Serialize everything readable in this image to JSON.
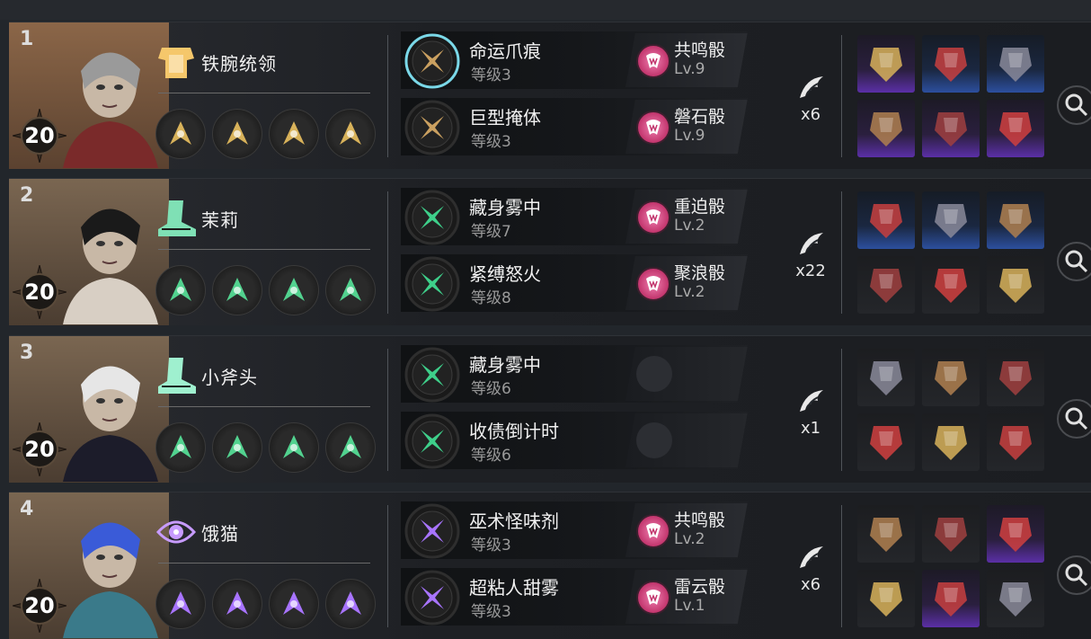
{
  "characters": [
    {
      "rank": "1",
      "level": "20",
      "name": "铁腕统领",
      "role_icon": "armor-icon",
      "role_color": "#f5c76b",
      "portrait": "gentleman-portrait",
      "trait_color": "#d8b25a",
      "skills": [
        {
          "name": "命运爪痕",
          "level": "等级3",
          "icon_color": "#caa060",
          "ring": "#7ad8e8",
          "dice": {
            "name": "共鸣骰",
            "lv": "Lv.9"
          }
        },
        {
          "name": "巨型掩体",
          "level": "等级3",
          "icon_color": "#caa060",
          "ring": "#2e2e2e",
          "dice": {
            "name": "磐石骰",
            "lv": "Lv.9"
          }
        }
      ],
      "claw_count": "x6",
      "items": [
        "purple",
        "blue",
        "blue",
        "purple",
        "purple",
        "purple"
      ]
    },
    {
      "rank": "2",
      "level": "20",
      "name": "茉莉",
      "role_icon": "boot-icon",
      "role_color": "#7fe0b5",
      "portrait": "lady-portrait",
      "trait_color": "#52d28f",
      "skills": [
        {
          "name": "藏身雾中",
          "level": "等级7",
          "icon_color": "#3ecf8a",
          "ring": "#2e2e2e",
          "dice": {
            "name": "重迫骰",
            "lv": "Lv.2"
          }
        },
        {
          "name": "紧缚怒火",
          "level": "等级8",
          "icon_color": "#3ecf8a",
          "ring": "#2e2e2e",
          "dice": {
            "name": "聚浪骰",
            "lv": "Lv.2"
          }
        }
      ],
      "claw_count": "x22",
      "items": [
        "blue",
        "blue",
        "blue",
        "dark",
        "dark",
        "dark"
      ]
    },
    {
      "rank": "3",
      "level": "20",
      "name": "小斧头",
      "role_icon": "boot-icon",
      "role_color": "#9ff0cf",
      "portrait": "pale-portrait",
      "trait_color": "#52d28f",
      "skills": [
        {
          "name": "藏身雾中",
          "level": "等级6",
          "icon_color": "#3ecf8a",
          "ring": "#2e2e2e",
          "dice": null
        },
        {
          "name": "收债倒计时",
          "level": "等级6",
          "icon_color": "#3ecf8a",
          "ring": "#2e2e2e",
          "dice": null
        }
      ],
      "claw_count": "x1",
      "items": [
        "dark",
        "dark",
        "dark",
        "dark",
        "dark",
        "dark"
      ]
    },
    {
      "rank": "4",
      "level": "20",
      "name": "饿猫",
      "role_icon": "eye-icon",
      "role_color": "#c79bff",
      "portrait": "blue-hair-portrait",
      "trait_color": "#a874ff",
      "skills": [
        {
          "name": "巫术怪味剂",
          "level": "等级3",
          "icon_color": "#a874ff",
          "ring": "#2e2e2e",
          "dice": {
            "name": "共鸣骰",
            "lv": "Lv.2"
          }
        },
        {
          "name": "超粘人甜雾",
          "level": "等级3",
          "icon_color": "#a874ff",
          "ring": "#2e2e2e",
          "dice": {
            "name": "雷云骰",
            "lv": "Lv.1"
          }
        }
      ],
      "claw_count": "x6",
      "items": [
        "dark",
        "dark",
        "purple",
        "dark",
        "purple",
        "dark"
      ]
    }
  ]
}
